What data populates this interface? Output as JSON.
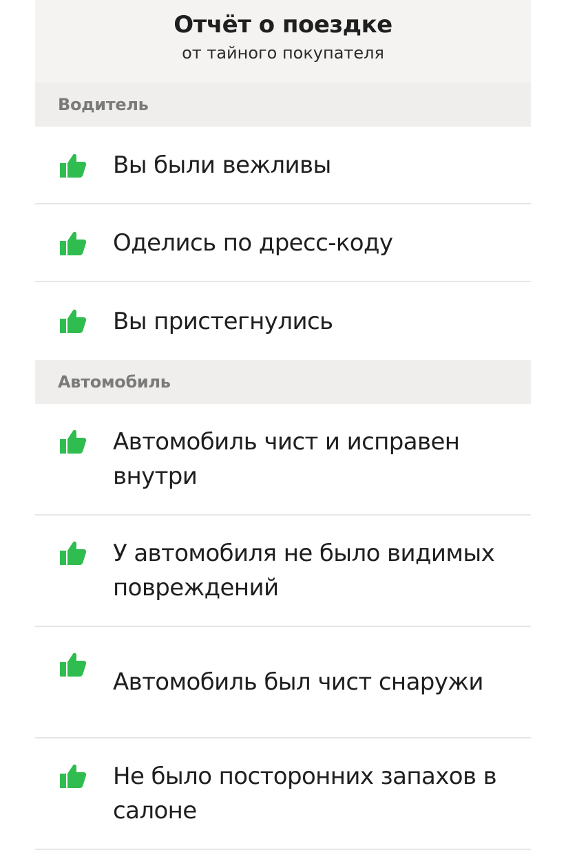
{
  "header": {
    "title": "Отчёт о поездке",
    "subtitle": "от тайного покупателя"
  },
  "colors": {
    "accent": "#2fbd4f",
    "section_bg": "#efeeec",
    "header_bg": "#f4f3f1",
    "section_text": "#7a7a7a",
    "divider": "#e6e6e6"
  },
  "sections": [
    {
      "title": "Водитель",
      "items": [
        {
          "text": "Вы были вежливы",
          "icon": "thumbs-up-icon"
        },
        {
          "text": "Оделись по дресс-коду",
          "icon": "thumbs-up-icon"
        },
        {
          "text": "Вы пристегнулись",
          "icon": "thumbs-up-icon"
        }
      ]
    },
    {
      "title": "Автомобиль",
      "items": [
        {
          "text": "Автомобиль чист и исправен внутри",
          "icon": "thumbs-up-icon"
        },
        {
          "text": "У автомобиля не было видимых повреждений",
          "icon": "thumbs-up-icon"
        },
        {
          "text": "Автомобиль был чист снаружи",
          "icon": "thumbs-up-icon"
        },
        {
          "text": "Не было посторонних запахов в салоне",
          "icon": "thumbs-up-icon"
        }
      ]
    }
  ]
}
